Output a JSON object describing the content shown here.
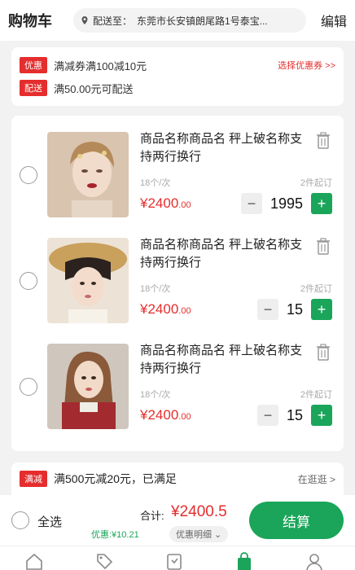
{
  "header": {
    "title": "购物车",
    "address_label": "配送至：",
    "address_value": "东莞市长安镇朗尾路1号泰宝...",
    "edit": "编辑"
  },
  "promos": [
    {
      "tag": "优惠",
      "text": "满减券满100减10元",
      "link": "选择优惠券 >>"
    },
    {
      "tag": "配送",
      "text": "满50.00元可配送"
    }
  ],
  "items": [
    {
      "name": "商品名称商品名 秤上破名称支持两行换行",
      "spec": "18个/次",
      "minimum": "2件起订",
      "price_int": "¥2400",
      "price_dec": ".00",
      "qty": "1995"
    },
    {
      "name": "商品名称商品名 秤上破名称支持两行换行",
      "spec": "18个/次",
      "minimum": "2件起订",
      "price_int": "¥2400",
      "price_dec": ".00",
      "qty": "15"
    },
    {
      "name": "商品名称商品名 秤上破名称支持两行换行",
      "spec": "18个/次",
      "minimum": "2件起订",
      "price_int": "¥2400",
      "price_dec": ".00",
      "qty": "15"
    }
  ],
  "discount": {
    "tag": "满减",
    "text": "满500元减20元，已满足",
    "link": "在逛逛 >"
  },
  "bottom": {
    "select_all": "全选",
    "total_label": "合计:",
    "total": "¥2400.5",
    "saving": "优惠:¥10.21",
    "detail": "优惠明细 ⌄",
    "checkout": "结算"
  },
  "colors": {
    "accent": "#1aa55a",
    "price": "#e52d2d"
  }
}
